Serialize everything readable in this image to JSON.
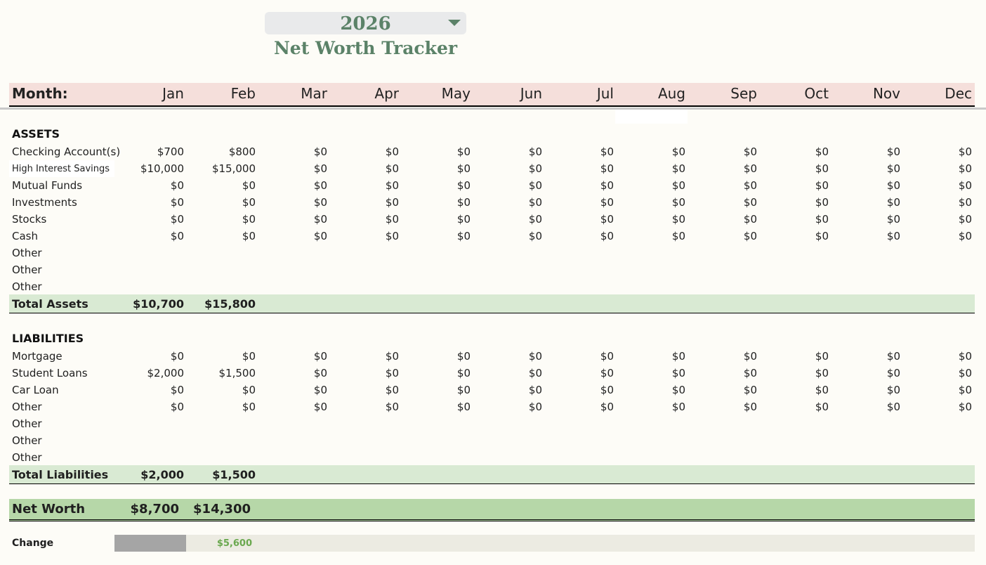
{
  "year_selector": {
    "value": "2026",
    "caret": "caret-down-icon"
  },
  "title": "Net Worth Tracker",
  "header": {
    "label": "Month:",
    "months": [
      "Jan",
      "Feb",
      "Mar",
      "Apr",
      "May",
      "Jun",
      "Jul",
      "Aug",
      "Sep",
      "Oct",
      "Nov",
      "Dec"
    ]
  },
  "assets": {
    "title": "ASSETS",
    "rows": [
      {
        "label": "Checking Account(s)",
        "values": [
          "$700",
          "$800",
          "$0",
          "$0",
          "$0",
          "$0",
          "$0",
          "$0",
          "$0",
          "$0",
          "$0",
          "$0"
        ]
      },
      {
        "label": "High Interest Savings",
        "values": [
          "$10,000",
          "$15,000",
          "$0",
          "$0",
          "$0",
          "$0",
          "$0",
          "$0",
          "$0",
          "$0",
          "$0",
          "$0"
        ]
      },
      {
        "label": "Mutual Funds",
        "values": [
          "$0",
          "$0",
          "$0",
          "$0",
          "$0",
          "$0",
          "$0",
          "$0",
          "$0",
          "$0",
          "$0",
          "$0"
        ]
      },
      {
        "label": "Investments",
        "values": [
          "$0",
          "$0",
          "$0",
          "$0",
          "$0",
          "$0",
          "$0",
          "$0",
          "$0",
          "$0",
          "$0",
          "$0"
        ]
      },
      {
        "label": "Stocks",
        "values": [
          "$0",
          "$0",
          "$0",
          "$0",
          "$0",
          "$0",
          "$0",
          "$0",
          "$0",
          "$0",
          "$0",
          "$0"
        ]
      },
      {
        "label": "Cash",
        "values": [
          "$0",
          "$0",
          "$0",
          "$0",
          "$0",
          "$0",
          "$0",
          "$0",
          "$0",
          "$0",
          "$0",
          "$0"
        ]
      },
      {
        "label": "Other",
        "values": []
      },
      {
        "label": "Other",
        "values": []
      },
      {
        "label": "Other",
        "values": []
      }
    ],
    "total": {
      "label": "Total Assets",
      "values": [
        "$10,700",
        "$15,800"
      ]
    }
  },
  "liabilities": {
    "title": "LIABILITIES",
    "rows": [
      {
        "label": "Mortgage",
        "values": [
          "$0",
          "$0",
          "$0",
          "$0",
          "$0",
          "$0",
          "$0",
          "$0",
          "$0",
          "$0",
          "$0",
          "$0"
        ]
      },
      {
        "label": "Student Loans",
        "values": [
          "$2,000",
          "$1,500",
          "$0",
          "$0",
          "$0",
          "$0",
          "$0",
          "$0",
          "$0",
          "$0",
          "$0",
          "$0"
        ]
      },
      {
        "label": "Car Loan",
        "values": [
          "$0",
          "$0",
          "$0",
          "$0",
          "$0",
          "$0",
          "$0",
          "$0",
          "$0",
          "$0",
          "$0",
          "$0"
        ]
      },
      {
        "label": "Other",
        "values": [
          "$0",
          "$0",
          "$0",
          "$0",
          "$0",
          "$0",
          "$0",
          "$0",
          "$0",
          "$0",
          "$0",
          "$0"
        ]
      },
      {
        "label": "Other",
        "values": []
      },
      {
        "label": "Other",
        "values": []
      },
      {
        "label": "Other",
        "values": []
      }
    ],
    "total": {
      "label": "Total Liabilities",
      "values": [
        "$2,000",
        "$1,500"
      ]
    }
  },
  "net_worth": {
    "label": "Net Worth",
    "values": [
      "$8,700",
      "$14,300"
    ]
  },
  "change": {
    "label": "Change",
    "values": [
      "",
      "$5,600"
    ]
  },
  "colors": {
    "accent_green": "#5b8268",
    "header_pink": "#f5dfdb",
    "total_green": "#d9ead3",
    "net_green": "#b6d7a8",
    "positive_change": "#6aa84f"
  }
}
